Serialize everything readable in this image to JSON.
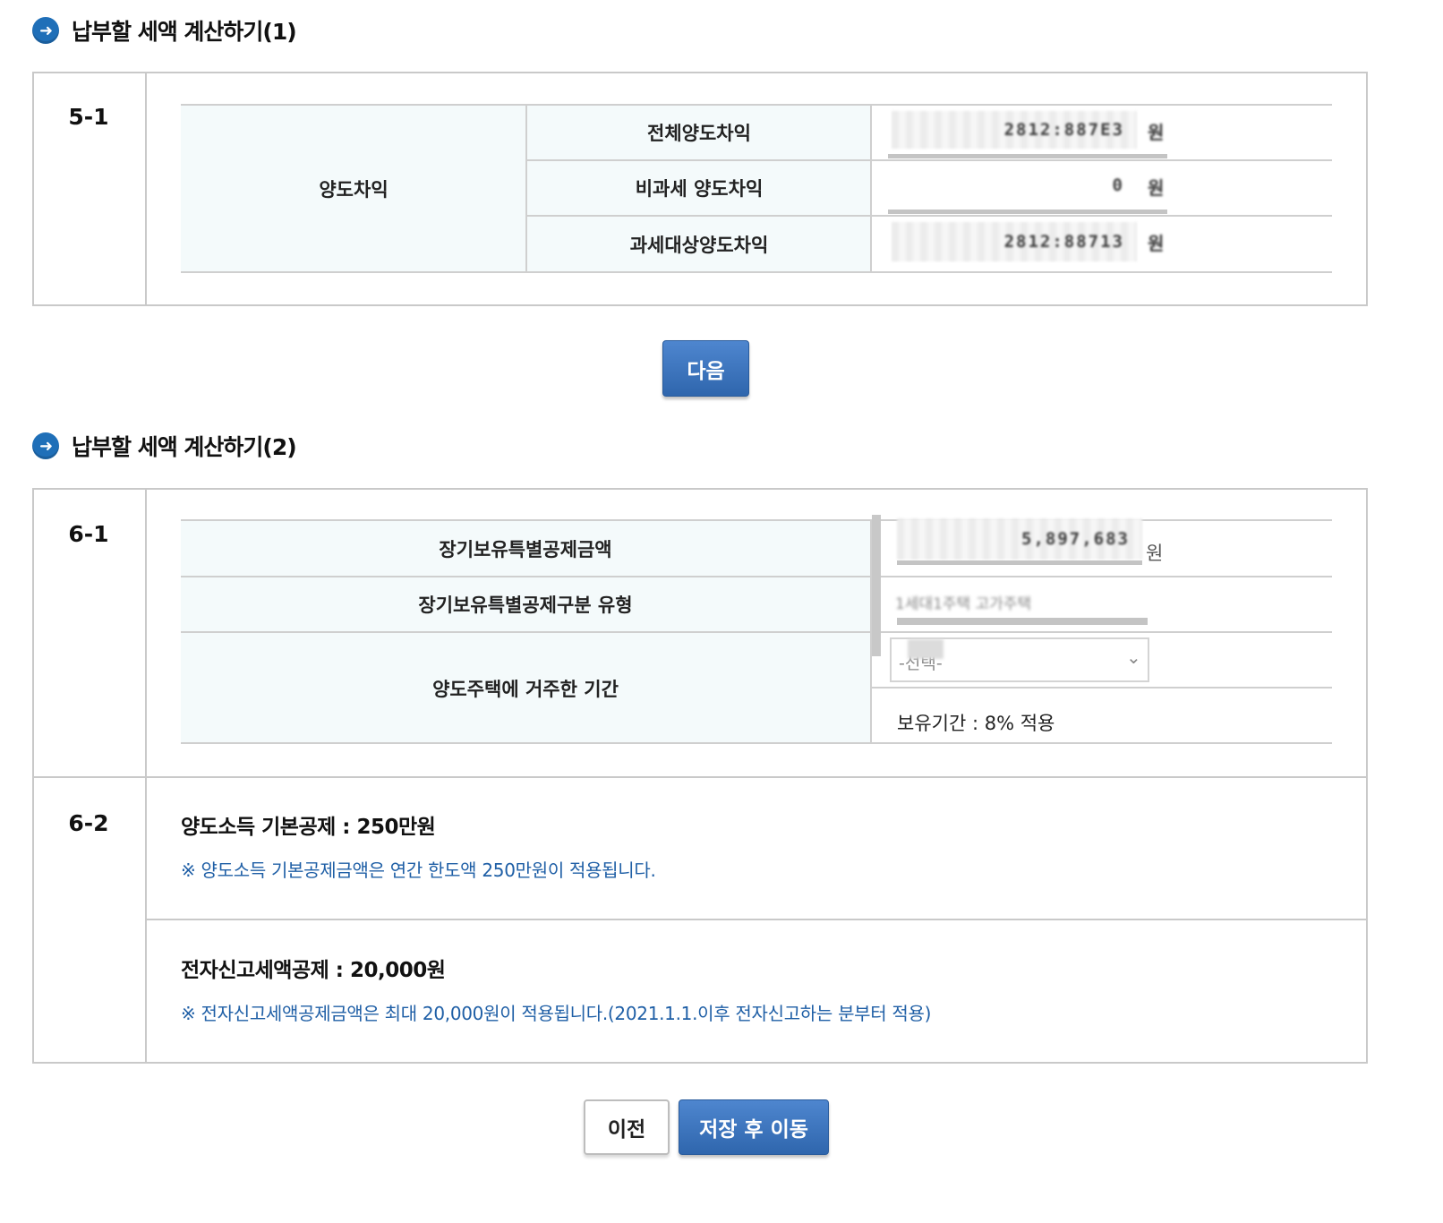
{
  "section1": {
    "title": "납부할 세액 계산하기(1)",
    "step": "5-1",
    "group_label": "양도차익",
    "rows": [
      {
        "label": "전체양도차익",
        "value": "2812:887E3",
        "unit": "원"
      },
      {
        "label": "비과세 양도차익",
        "value": "0",
        "unit": "원"
      },
      {
        "label": "과세대상양도차익",
        "value": "2812:88713",
        "unit": "원"
      }
    ],
    "next_button": "다음"
  },
  "section2": {
    "title": "납부할 세액 계산하기(2)",
    "step1": "6-1",
    "rows": [
      {
        "label": "장기보유특별공제금액",
        "value": "5,897,683",
        "unit": "원"
      },
      {
        "label": "장기보유특별공제구분 유형",
        "value": "1세대1주택 고가주택"
      },
      {
        "label": "양도주택에 거주한 기간",
        "select_value": "-선택-",
        "placeholder_blur": "선택",
        "note": "보유기간 : 8% 적용"
      }
    ],
    "step2": "6-2",
    "basic_deduction": {
      "title": "양도소득 기본공제 : 250만원",
      "note": "※  양도소득 기본공제금액은 연간 한도액 250만원이 적용됩니다."
    },
    "e_filing": {
      "title": "전자신고세액공제 : 20,000원",
      "note": "※  전자신고세액공제금액은 최대 20,000원이 적용됩니다.(2021.1.1.이후 전자신고하는 분부터 적용)"
    }
  },
  "footer": {
    "prev_button": "이전",
    "save_button": "저장 후 이동"
  },
  "colors": {
    "accent": "#2f66ad",
    "note_text": "#1f5fa6",
    "label_bg": "#f4fafb",
    "border": "#c9c9c9"
  }
}
